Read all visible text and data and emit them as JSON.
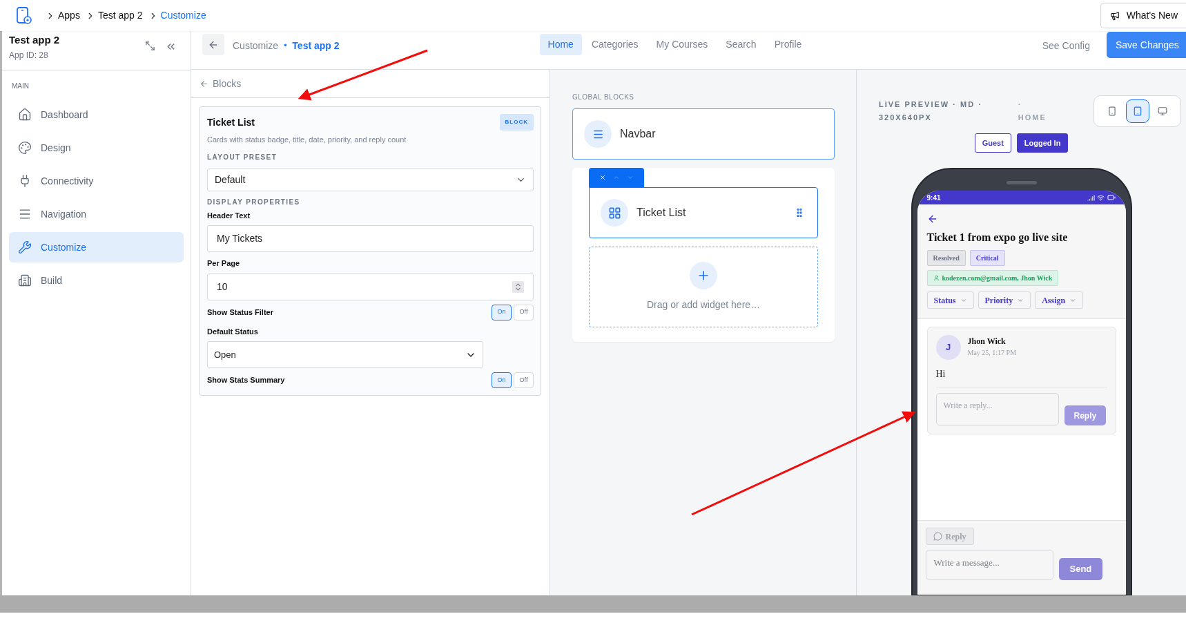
{
  "breadcrumb": [
    {
      "label": "Apps",
      "selected": false
    },
    {
      "label": "Test app 2",
      "selected": false
    },
    {
      "label": "Customize",
      "selected": true
    }
  ],
  "whats_new": "What's New",
  "sidebar": {
    "app_name": "Test app 2",
    "app_id": "App ID: 28",
    "section": "MAIN",
    "items": [
      {
        "label": "Dashboard",
        "selected": false
      },
      {
        "label": "Design",
        "selected": false
      },
      {
        "label": "Connectivity",
        "selected": false
      },
      {
        "label": "Navigation",
        "selected": false
      },
      {
        "label": "Customize",
        "selected": true
      },
      {
        "label": "Build",
        "selected": false
      }
    ]
  },
  "subheader": {
    "title": "Customize",
    "separator": "•",
    "app": "Test app 2",
    "tabs": [
      {
        "label": "Home",
        "selected": true
      },
      {
        "label": "Categories",
        "selected": false
      },
      {
        "label": "My Courses",
        "selected": false
      },
      {
        "label": "Search",
        "selected": false
      },
      {
        "label": "Profile",
        "selected": false
      }
    ],
    "see_config": "See Config",
    "save": "Save Changes"
  },
  "settings": {
    "back": "Blocks",
    "title": "Ticket List",
    "badge": "BLOCK",
    "description": "Cards with status badge, title, date, priority, and reply count",
    "layout_label": "LAYOUT PRESET",
    "layout_value": "Default",
    "display_label": "DISPLAY PROPERTIES",
    "fields": [
      {
        "kind": "text",
        "label": "Header Text",
        "value": "My Tickets"
      },
      {
        "kind": "number",
        "label": "Per Page",
        "value": "10"
      },
      {
        "kind": "toggle",
        "label": "Show Status Filter",
        "on": true,
        "on_label": "On",
        "off_label": "Off"
      },
      {
        "kind": "select",
        "label": "Default Status",
        "value": "Open"
      },
      {
        "kind": "toggle",
        "label": "Show Stats Summary",
        "on": true,
        "on_label": "On",
        "off_label": "Off"
      }
    ]
  },
  "canvas": {
    "heading": "GLOBAL BLOCKS",
    "global_blocks": [
      {
        "label": "Navbar"
      }
    ],
    "blocks": [
      {
        "label": "Ticket List",
        "selected": true
      }
    ],
    "drop_hint": "Drag or add widget here…"
  },
  "preview": {
    "title_line1": "LIVE PREVIEW · MD ·",
    "title_line2": "320X640PX",
    "page_sep": "·",
    "page": "HOME",
    "devices": [
      {
        "kind": "phone",
        "selected": false
      },
      {
        "kind": "tablet",
        "selected": true
      },
      {
        "kind": "desktop",
        "selected": false
      }
    ],
    "auth": [
      {
        "label": "Guest",
        "selected": false
      },
      {
        "label": "Logged In",
        "selected": true
      }
    ],
    "phone": {
      "time": "9:41",
      "title": "Ticket 1 from expo go live site",
      "badges": [
        {
          "label": "Resolved",
          "kind": "status"
        },
        {
          "label": "Critical",
          "kind": "priority"
        }
      ],
      "assignee": "kodezen.com@gmail.com, Jhon Wick",
      "filters": [
        "Status",
        "Priority",
        "Assign"
      ],
      "reply": {
        "avatar": "J",
        "author": "Jhon Wick",
        "date": "May 25, 1:17 PM",
        "body": "Hi",
        "placeholder": "Write a reply...",
        "button": "Reply"
      },
      "composer": {
        "tab": "Reply",
        "placeholder": "Write a message...",
        "send": "Send"
      }
    }
  }
}
